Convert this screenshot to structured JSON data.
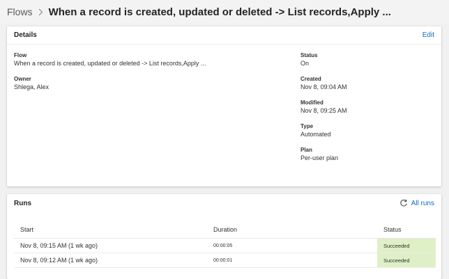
{
  "breadcrumb": {
    "root": "Flows",
    "title": "When a record is created, updated or deleted -> List records,Apply ..."
  },
  "details": {
    "title": "Details",
    "edit_label": "Edit",
    "flow_label": "Flow",
    "flow_value": "When a record is created, updated or deleted -> List records,Apply ...",
    "owner_label": "Owner",
    "owner_value": "Shlega, Alex",
    "status_label": "Status",
    "status_value": "On",
    "created_label": "Created",
    "created_value": "Nov 8, 09:04 AM",
    "modified_label": "Modified",
    "modified_value": "Nov 8, 09:25 AM",
    "type_label": "Type",
    "type_value": "Automated",
    "plan_label": "Plan",
    "plan_value": "Per-user plan"
  },
  "runs": {
    "title": "Runs",
    "all_runs_label": "All runs",
    "columns": {
      "start": "Start",
      "duration": "Duration",
      "status": "Status"
    },
    "rows": [
      {
        "start": "Nov 8, 09:15 AM (1 wk ago)",
        "duration": "00:00:05",
        "status": "Succeeded"
      },
      {
        "start": "Nov 8, 09:12 AM (1 wk ago)",
        "duration": "00:00:01",
        "status": "Succeeded"
      }
    ]
  },
  "icons": {
    "breadcrumb_separator": "chevron-right-icon",
    "all_runs": "refresh-icon"
  },
  "colors": {
    "link": "#0f6cbd",
    "success_bg": "#dff0c6"
  }
}
